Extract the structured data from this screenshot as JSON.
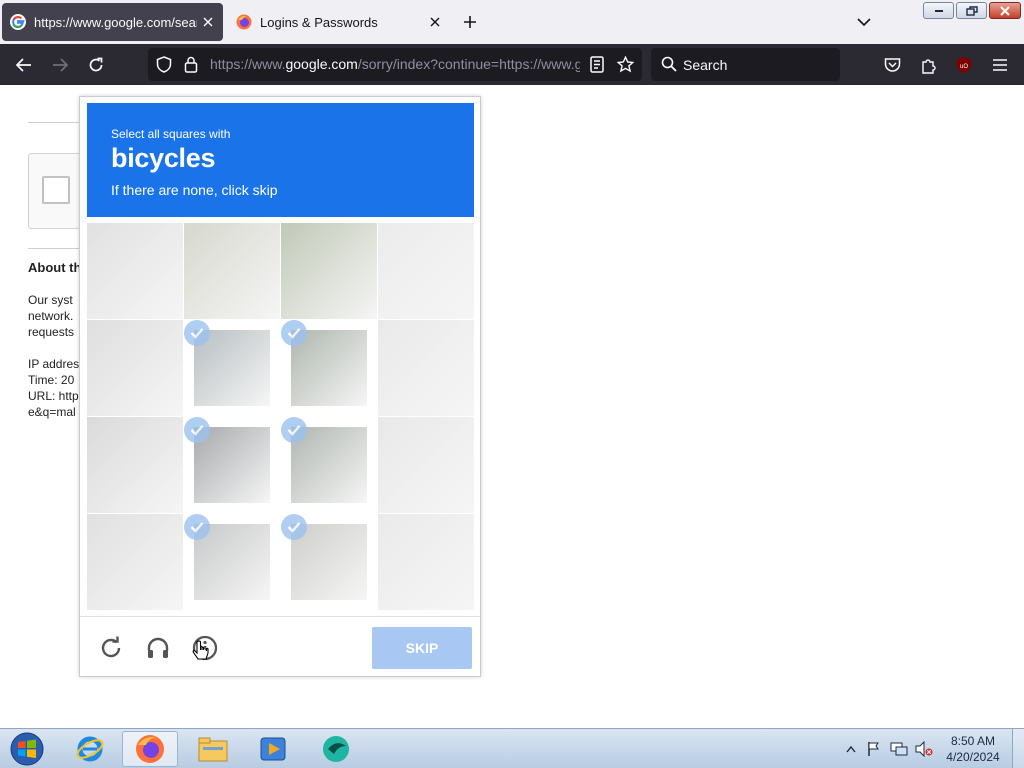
{
  "browser": {
    "tabs": [
      {
        "title": "https://www.google.com/search?q=",
        "active": true,
        "favicon": "google-g-icon"
      },
      {
        "title": "Logins & Passwords",
        "active": false,
        "favicon": "firefox-icon"
      }
    ],
    "url": {
      "prefix": "https://www.",
      "domain": "google.com",
      "rest": "/sorry/index?continue=https://www.google.com/search"
    },
    "search_placeholder": "Search",
    "accent": "#2b2a33"
  },
  "page": {
    "about_title": "About th",
    "paragraph1": [
      "Our syst",
      "network.",
      "requests"
    ],
    "paragraph2": [
      "IP addres",
      "Time: 20",
      "URL: http",
      "e&q=mal"
    ]
  },
  "captcha": {
    "instruction": "Select all squares with",
    "target": "bicycles",
    "subtext": "If there are none, click skip",
    "skip_label": "SKIP",
    "header_color": "#1a73e8",
    "selected_cells": [
      5,
      6,
      9,
      10,
      13,
      14
    ],
    "footer_icons": [
      "reload-icon",
      "audio-headphones-icon",
      "info-icon"
    ]
  },
  "taskbar": {
    "time": "8:50 AM",
    "date": "4/20/2024",
    "apps": [
      "internet-explorer-icon",
      "firefox-icon",
      "file-explorer-icon",
      "media-player-icon",
      "app-icon"
    ]
  }
}
